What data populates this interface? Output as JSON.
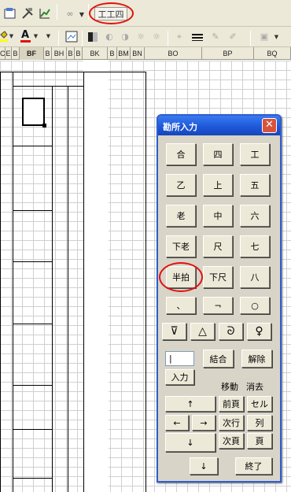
{
  "toolbar": {
    "font_select_value": "工工四"
  },
  "columns": [
    "C",
    "E",
    "B",
    "BF",
    "B",
    "BH",
    "B",
    "B",
    "BK",
    "B",
    "BM",
    "BN",
    "BO",
    "BP",
    "BQ"
  ],
  "dialog": {
    "title": "勘所入力",
    "close_label": "✕",
    "note_buttons": [
      "合",
      "四",
      "工",
      "乙",
      "上",
      "五",
      "老",
      "中",
      "六",
      "下老",
      "尺",
      "七",
      "半拍",
      "下尺",
      "八",
      "、",
      "¬",
      "○"
    ],
    "symbol_buttons": [
      "⊽",
      "△",
      "ᘐ",
      "♀"
    ],
    "text_field_value": "|",
    "combine_label": "結合",
    "release_label": "解除",
    "input_label": "入力",
    "move_label": "移動",
    "delete_label": "消去",
    "up_label": "↑",
    "left_label": "←",
    "right_label": "→",
    "down_label": "↓",
    "down2_label": "↓",
    "prev_page_label": "前頁",
    "next_row_label": "次行",
    "next_page_label": "次頁",
    "cell_label": "セル",
    "column_label": "列",
    "page_label": "頁",
    "end_label": "終了"
  }
}
